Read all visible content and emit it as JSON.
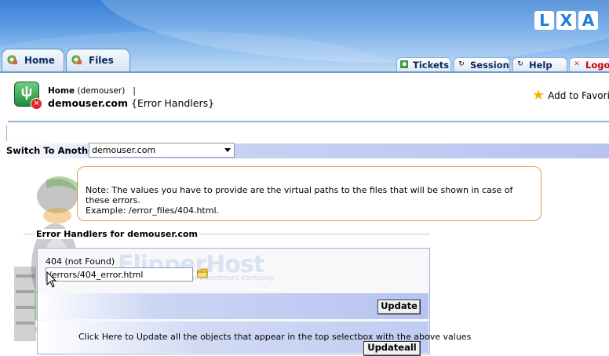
{
  "brand": {
    "logo_letters": [
      "L",
      "X",
      "A"
    ]
  },
  "tabs": [
    {
      "label": "Home",
      "icon": "gear-icon"
    },
    {
      "label": "Files",
      "icon": "gear-icon"
    }
  ],
  "right_tabs": [
    {
      "label": "Tickets",
      "icon": "ticket-icon"
    },
    {
      "label": "Session",
      "icon": "session-icon"
    },
    {
      "label": "Help",
      "icon": "help-icon"
    },
    {
      "label": "Logout",
      "icon": "close-icon"
    }
  ],
  "breadcrumb": {
    "home": "Home",
    "user": "(demouser)",
    "sep": "|"
  },
  "title": {
    "domain": "demouser.com",
    "section": "{Error Handlers}"
  },
  "favorites": {
    "label": "Add to Favorites"
  },
  "switch": {
    "label": "Switch To Another",
    "selected": "demouser.com"
  },
  "note": {
    "line1": "Note: The values you have to provide are the virtual paths to the files that will be shown in case of these errors.",
    "line2": "Example: /error_files/404.html."
  },
  "form": {
    "legend": "Error Handlers for demouser.com",
    "watermark": "FlipperHost",
    "watermark_sub": "an investment company",
    "field_label": "404 (not Found)",
    "field_value": "/errors/404_error.html",
    "update_label": "Update",
    "updateall_text": "Click Here to Update all the objects that appear in the top selectbox with the above values",
    "updateall_label": "Updateall"
  },
  "colors": {
    "header_blue": "#3a7fd3",
    "accent_orange": "#e0a050",
    "tab_border": "#5f8fc6"
  }
}
